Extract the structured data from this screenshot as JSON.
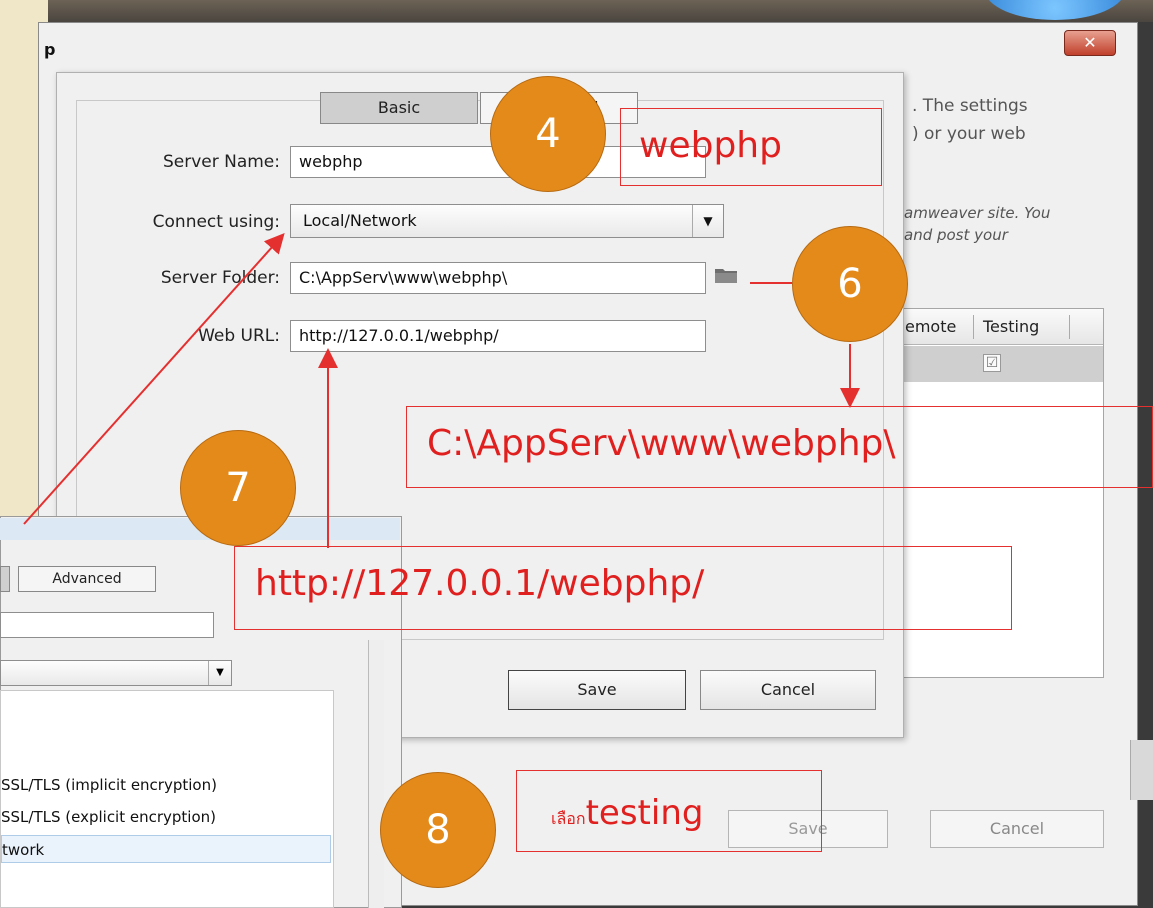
{
  "back_window": {
    "title_fragment": "p",
    "close_label": "✕",
    "info_line1": ". The settings",
    "info_line2": ") or your web",
    "info_line3": "amweaver site. You",
    "info_line4": "and post your",
    "columns": [
      "emote",
      "Testing"
    ],
    "testing_check": "☑",
    "save_label": "Save",
    "cancel_label": "Cancel"
  },
  "server_dialog": {
    "tabs": [
      "Basic",
      "Advanced"
    ],
    "server_name_label": "Server Name:",
    "server_name_value": "webphp",
    "connect_label": "Connect using:",
    "connect_value": "Local/Network",
    "folder_label": "Server Folder:",
    "folder_value": "C:\\AppServ\\www\\webphp\\",
    "url_label": "Web URL:",
    "url_value": "http://127.0.0.1/webphp/",
    "save_label": "Save",
    "cancel_label": "Cancel"
  },
  "small_dialog": {
    "advanced_tab": "Advanced",
    "dropdown_items": [
      "SSL/TLS (implicit encryption)",
      "SSL/TLS (explicit encryption)",
      "twork"
    ],
    "selected_item": "twork"
  },
  "annotations": {
    "step4": "4",
    "step6": "6",
    "step7": "7",
    "step8": "8",
    "note_server_name": "webphp",
    "note_folder": "C:\\AppServ\\www\\webphp\\",
    "note_url": "http://127.0.0.1/webphp/",
    "note_testing_thai": "เลือก",
    "note_testing": "testing"
  },
  "colors": {
    "annotation_circle": "#e48a1b",
    "annotation_red": "#e53030",
    "dialog_bg": "#f0f0f0"
  }
}
